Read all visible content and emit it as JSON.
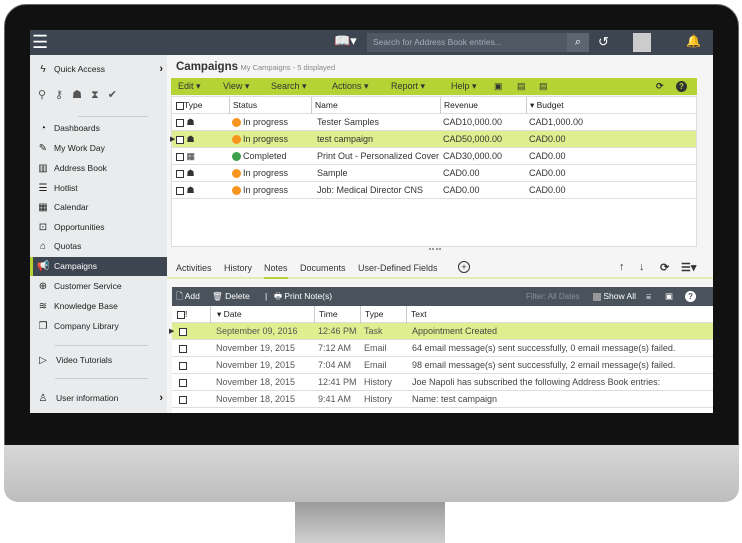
{
  "topbar": {
    "search_placeholder": "Search for Address Book entries..."
  },
  "sidebar": {
    "items": [
      {
        "label": "Quick Access",
        "icon": "lightning-icon"
      },
      {
        "label": "Dashboards",
        "icon": "gauge-icon"
      },
      {
        "label": "My Work Day",
        "icon": "edit-icon"
      },
      {
        "label": "Address Book",
        "icon": "book-icon"
      },
      {
        "label": "Hotlist",
        "icon": "list-icon"
      },
      {
        "label": "Calendar",
        "icon": "calendar-icon"
      },
      {
        "label": "Opportunities",
        "icon": "briefcase-icon"
      },
      {
        "label": "Quotas",
        "icon": "bank-icon"
      },
      {
        "label": "Campaigns",
        "icon": "megaphone-icon"
      },
      {
        "label": "Customer Service",
        "icon": "lifebuoy-icon"
      },
      {
        "label": "Knowledge Base",
        "icon": "layers-icon"
      },
      {
        "label": "Company Library",
        "icon": "documents-icon"
      },
      {
        "label": "Video Tutorials",
        "icon": "play-icon"
      },
      {
        "label": "User information",
        "icon": "user-icon"
      }
    ],
    "active": "Campaigns"
  },
  "campaigns": {
    "title": "Campaigns",
    "subtitle": "My Campaigns - 5 displayed",
    "menu": [
      "Edit",
      "View",
      "Search",
      "Actions",
      "Report",
      "Help"
    ],
    "columns": [
      "Type",
      "Status",
      "Name",
      "Revenue",
      "Budget"
    ],
    "rows": [
      {
        "status": "In progress",
        "name": "Tester Samples",
        "revenue": "CAD10,000.00",
        "budget": "CAD1,000.00"
      },
      {
        "status": "In progress",
        "name": "test campaign",
        "revenue": "CAD50,000.00",
        "budget": "CAD0.00",
        "selected": true
      },
      {
        "status": "Completed",
        "name": "Print Out - Personalized Cover",
        "revenue": "CAD30,000.00",
        "budget": "CAD0.00"
      },
      {
        "status": "In progress",
        "name": "Sample",
        "revenue": "CAD0.00",
        "budget": "CAD0.00"
      },
      {
        "status": "In progress",
        "name": "Job: Medical Director CNS",
        "revenue": "CAD0.00",
        "budget": "CAD0.00"
      }
    ]
  },
  "tabs": {
    "items": [
      "Activities",
      "History",
      "Notes",
      "Documents",
      "User-Defined Fields"
    ],
    "active": "Notes"
  },
  "notes": {
    "add": "Add",
    "delete": "Delete",
    "print": "Print Note(s)",
    "filter": "Filter: All Dates",
    "show_all": "Show All",
    "columns": [
      "!",
      "Date",
      "Time",
      "Type",
      "Text"
    ],
    "rows": [
      {
        "date": "September 09, 2016",
        "time": "12:46 PM",
        "type": "Task",
        "text": "Appointment Created",
        "selected": true
      },
      {
        "date": "November 19, 2015",
        "time": "7:12 AM",
        "type": "Email",
        "text": "64 email message(s) sent successfully, 0 email message(s) failed."
      },
      {
        "date": "November 19, 2015",
        "time": "7:04 AM",
        "type": "Email",
        "text": "98 email message(s) sent successfully, 2 email message(s) failed."
      },
      {
        "date": "November 18, 2015",
        "time": "12:41 PM",
        "type": "History",
        "text": "Joe Napoli has subscribed the following Address Book entries:"
      },
      {
        "date": "November 18, 2015",
        "time": "9:41 AM",
        "type": "History",
        "text": "Name: test campaign"
      }
    ]
  },
  "colors": {
    "accent": "#b5d334",
    "dark": "#3d4550",
    "in_progress": "#f7941d",
    "completed": "#3aa04a"
  }
}
